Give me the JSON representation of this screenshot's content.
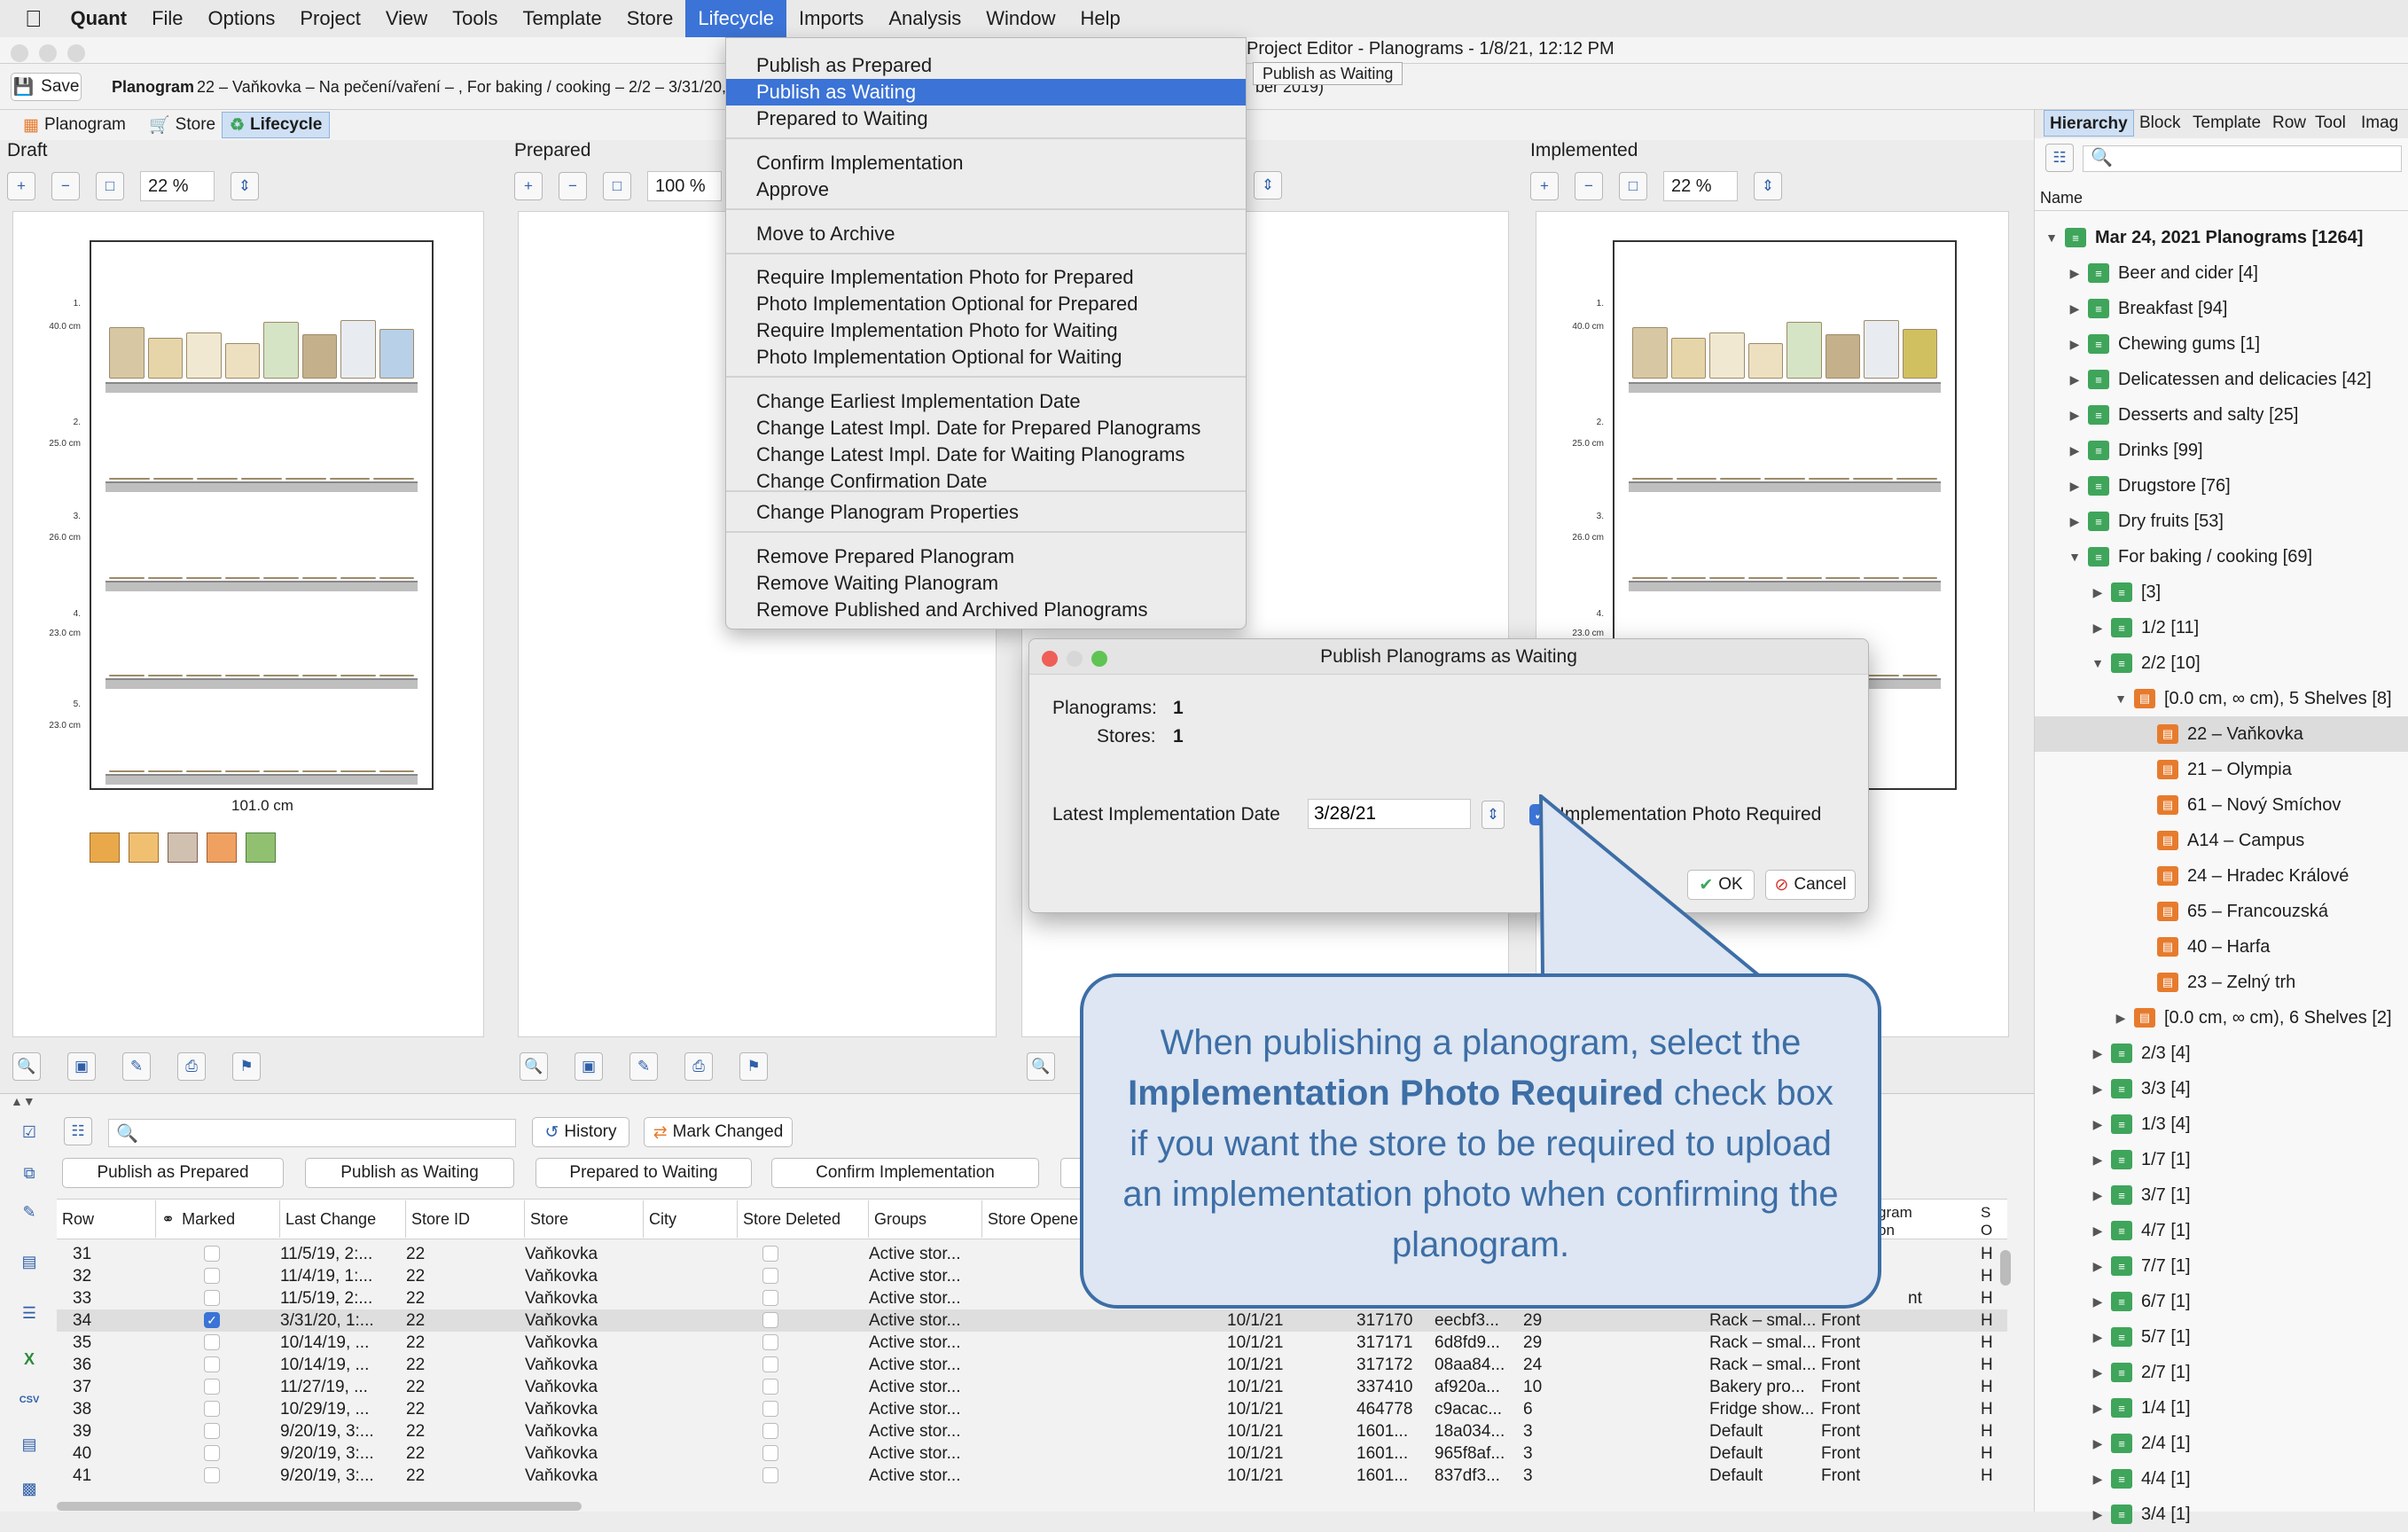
{
  "menubar": {
    "apple": "",
    "app": "Quant",
    "items": [
      "File",
      "Options",
      "Project",
      "View",
      "Tools",
      "Template",
      "Store",
      "Lifecycle",
      "Imports",
      "Analysis",
      "Window",
      "Help"
    ],
    "active": "Lifecycle"
  },
  "window": {
    "title": "Project Editor - Planograms - 1/8/21, 12:12 PM"
  },
  "toolbar": {
    "save_label": "Save",
    "planogram_label": "Planogram",
    "planogram_info": "22 – Vaňkovka – Na pečení/vaření – , For baking / cooking – 2/2 – 3/31/20, 1",
    "planogram_info_tail": "ber 2019)"
  },
  "tabs": {
    "planogram": "Planogram",
    "store": "Store",
    "lifecycle": "Lifecycle"
  },
  "panels": {
    "draft": {
      "title": "Draft",
      "zoom": "22 %",
      "width_label": "101.0 cm"
    },
    "prepared": {
      "title": "Prepared",
      "zoom": "100 %"
    },
    "implemented": {
      "title": "Implemented",
      "zoom": "22 %"
    }
  },
  "shelf_labels": [
    {
      "num": "1.",
      "h": "40.0 cm"
    },
    {
      "num": "2.",
      "h": "25.0 cm"
    },
    {
      "num": "3.",
      "h": "26.0 cm"
    },
    {
      "num": "4.",
      "h": "23.0 cm"
    },
    {
      "num": "5.",
      "h": "23.0 cm"
    }
  ],
  "lifecycle_menu": {
    "items": [
      "Publish as Prepared",
      "Publish as Waiting",
      "Prepared to Waiting",
      "Confirm Implementation",
      "Approve",
      "Move to Archive",
      "Require Implementation Photo for Prepared",
      "Photo Implementation Optional for Prepared",
      "Require Implementation Photo for Waiting",
      "Photo Implementation Optional for Waiting",
      "Change Earliest Implementation Date",
      "Change Latest Impl. Date for Prepared Planograms",
      "Change Latest Impl. Date for Waiting Planograms",
      "Change Confirmation Date",
      "Change Planogram Properties",
      "Remove Prepared Planogram",
      "Remove Waiting Planogram",
      "Remove Published and Archived Planograms"
    ],
    "highlighted": "Publish as Waiting",
    "tooltip": "Publish as Waiting"
  },
  "right_panel": {
    "tabs": [
      "Hierarchy",
      "Block",
      "Template",
      "Row",
      "Tool",
      "Imag"
    ],
    "column": "Name",
    "tree": [
      {
        "label": "Mar 24, 2021 Planograms [1264]",
        "bold": true
      },
      {
        "label": "Beer and cider [4]"
      },
      {
        "label": "Breakfast [94]"
      },
      {
        "label": "Chewing gums [1]"
      },
      {
        "label": "Delicatessen and delicacies [42]"
      },
      {
        "label": "Desserts and salty [25]"
      },
      {
        "label": "Drinks [99]"
      },
      {
        "label": "Drugstore [76]"
      },
      {
        "label": "Dry fruits [53]"
      },
      {
        "label": "For baking / cooking [69]"
      },
      {
        "label": "[3]"
      },
      {
        "label": "1/2 [11]"
      },
      {
        "label": "2/2 [10]"
      },
      {
        "label": "[0.0 cm, ∞ cm), 5 Shelves [8]"
      },
      {
        "label": "22 – Vaňkovka"
      },
      {
        "label": "21 – Olympia"
      },
      {
        "label": "61 – Nový Smíchov"
      },
      {
        "label": "A14 – Campus"
      },
      {
        "label": "24 – Hradec Králové"
      },
      {
        "label": "65 – Francouzská"
      },
      {
        "label": "40 – Harfa"
      },
      {
        "label": "23 – Zelný trh"
      },
      {
        "label": "[0.0 cm, ∞ cm), 6 Shelves [2]"
      },
      {
        "label": "2/3 [4]"
      },
      {
        "label": "3/3 [4]"
      },
      {
        "label": "1/3 [4]"
      },
      {
        "label": "1/7 [1]"
      },
      {
        "label": "3/7 [1]"
      },
      {
        "label": "4/7 [1]"
      },
      {
        "label": "7/7 [1]"
      },
      {
        "label": "6/7 [1]"
      },
      {
        "label": "5/7 [1]"
      },
      {
        "label": "2/7 [1]"
      },
      {
        "label": "1/4 [1]"
      },
      {
        "label": "2/4 [1]"
      },
      {
        "label": "4/4 [1]"
      },
      {
        "label": "3/4 [1]"
      }
    ]
  },
  "bottom": {
    "history": "History",
    "mark_changed": "Mark Changed",
    "actions": [
      "Publish as Prepared",
      "Publish as Waiting",
      "Prepared to Waiting",
      "Confirm Implementation"
    ],
    "columns": [
      "Row",
      "Marked",
      "Last Change",
      "Store ID",
      "Store",
      "City",
      "Store Deleted",
      "Groups",
      "Store Opene"
    ],
    "right_columns": [
      "gram",
      "on",
      "S",
      "O"
    ],
    "rows": [
      {
        "row": "31",
        "marked": false,
        "last": "11/5/19, 2:...",
        "sid": "22",
        "store": "Vaňkovka",
        "groups": "Active stor...",
        "d1": "",
        "d2": "",
        "d3": "",
        "d4": "",
        "d5": "",
        "d6": "",
        "side": "",
        "h": "H"
      },
      {
        "row": "32",
        "marked": false,
        "last": "11/4/19, 1:...",
        "sid": "22",
        "store": "Vaňkovka",
        "groups": "Active stor...",
        "d1": "",
        "d2": "",
        "d3": "",
        "d4": "",
        "d5": "",
        "d6": "",
        "side": "",
        "h": "H"
      },
      {
        "row": "33",
        "marked": false,
        "last": "11/5/19, 2:...",
        "sid": "22",
        "store": "Vaňkovka",
        "groups": "Active stor...",
        "d1": "",
        "d2": "",
        "d3": "",
        "d4": "",
        "d5": "",
        "d6": "",
        "side": "nt",
        "h": "H"
      },
      {
        "row": "34",
        "marked": true,
        "last": "3/31/20, 1:...",
        "sid": "22",
        "store": "Vaňkovka",
        "groups": "Active stor...",
        "d1": "10/1/21",
        "d2": "317170",
        "d3": "eecbf3...",
        "d4": "29",
        "d5": "Rack – smal...",
        "d6": "Front",
        "side": "",
        "h": "H"
      },
      {
        "row": "35",
        "marked": false,
        "last": "10/14/19, ...",
        "sid": "22",
        "store": "Vaňkovka",
        "groups": "Active stor...",
        "d1": "10/1/21",
        "d2": "317171",
        "d3": "6d8fd9...",
        "d4": "29",
        "d5": "Rack – smal...",
        "d6": "Front",
        "side": "",
        "h": "H"
      },
      {
        "row": "36",
        "marked": false,
        "last": "10/14/19, ...",
        "sid": "22",
        "store": "Vaňkovka",
        "groups": "Active stor...",
        "d1": "10/1/21",
        "d2": "317172",
        "d3": "08aa84...",
        "d4": "24",
        "d5": "Rack – smal...",
        "d6": "Front",
        "side": "",
        "h": "H"
      },
      {
        "row": "37",
        "marked": false,
        "last": "11/27/19, ...",
        "sid": "22",
        "store": "Vaňkovka",
        "groups": "Active stor...",
        "d1": "10/1/21",
        "d2": "337410",
        "d3": "af920a...",
        "d4": "10",
        "d5": "Bakery pro...",
        "d6": "Front",
        "side": "",
        "h": "H"
      },
      {
        "row": "38",
        "marked": false,
        "last": "10/29/19, ...",
        "sid": "22",
        "store": "Vaňkovka",
        "groups": "Active stor...",
        "d1": "10/1/21",
        "d2": "464778",
        "d3": "c9acac...",
        "d4": "6",
        "d5": "Fridge show...",
        "d6": "Front",
        "side": "",
        "h": "H"
      },
      {
        "row": "39",
        "marked": false,
        "last": "9/20/19, 3:...",
        "sid": "22",
        "store": "Vaňkovka",
        "groups": "Active stor...",
        "d1": "10/1/21",
        "d2": "1601...",
        "d3": "18a034...",
        "d4": "3",
        "d5": "Default",
        "d6": "Front",
        "side": "",
        "h": "H"
      },
      {
        "row": "40",
        "marked": false,
        "last": "9/20/19, 3:...",
        "sid": "22",
        "store": "Vaňkovka",
        "groups": "Active stor...",
        "d1": "10/1/21",
        "d2": "1601...",
        "d3": "965f8af...",
        "d4": "3",
        "d5": "Default",
        "d6": "Front",
        "side": "",
        "h": "H"
      },
      {
        "row": "41",
        "marked": false,
        "last": "9/20/19, 3:...",
        "sid": "22",
        "store": "Vaňkovka",
        "groups": "Active stor...",
        "d1": "10/1/21",
        "d2": "1601...",
        "d3": "837df3...",
        "d4": "3",
        "d5": "Default",
        "d6": "Front",
        "side": "",
        "h": "H"
      }
    ]
  },
  "dialog": {
    "title": "Publish Planograms as Waiting",
    "planograms_label": "Planograms:",
    "planograms_value": "1",
    "stores_label": "Stores:",
    "stores_value": "1",
    "date_label": "Latest Implementation Date",
    "date_value": "3/28/21",
    "photo_label": "Implementation Photo Required",
    "photo_checked": true,
    "ok": "OK",
    "cancel": "Cancel"
  },
  "callout": {
    "pre": "When publishing a planogram, select the",
    "bold": "Implementation Photo Required",
    "post": "check box if you want the store to be required to upload an implementation photo when confirming the planogram."
  },
  "colors": {
    "accent": "#3b73d6",
    "callout_border": "#3d6ea6",
    "callout_bg": "#dde6f2",
    "selection": "#cfe0f4"
  }
}
